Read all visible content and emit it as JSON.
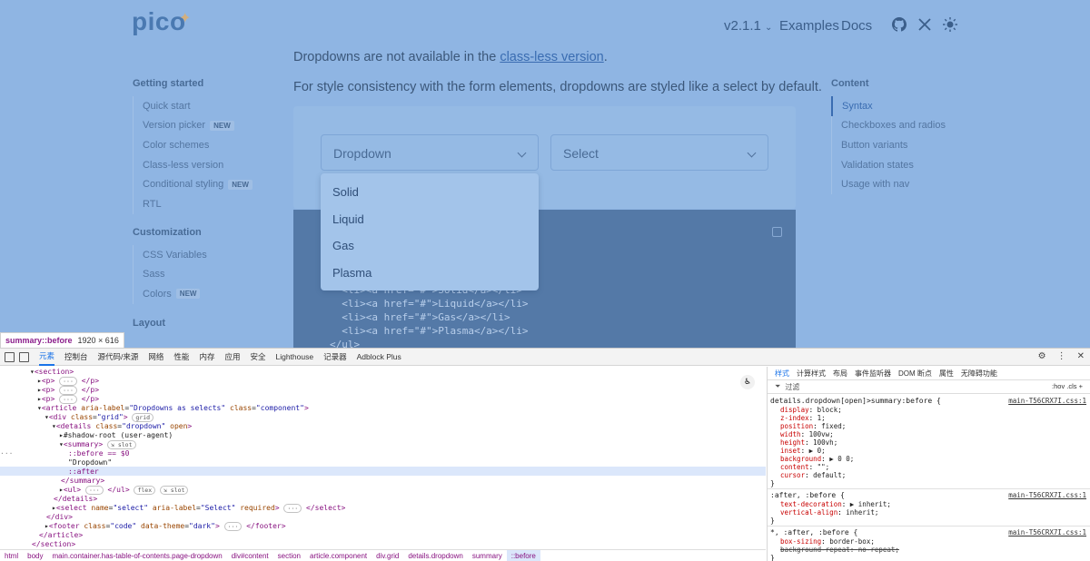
{
  "site": {
    "logo": "pico",
    "version": "v2.1.1",
    "nav": {
      "examples": "Examples",
      "docs": "Docs"
    },
    "nav_icons": [
      "github-icon",
      "x-icon",
      "theme-toggle-icon"
    ]
  },
  "intro": {
    "line1_prefix": "Dropdowns are not available in the ",
    "line1_link": "class-less version",
    "line1_suffix": ".",
    "line2": "For style consistency with the form elements, dropdowns are styled like a select by default."
  },
  "sidebar": {
    "sections": [
      {
        "title": "Getting started",
        "items": [
          {
            "label": "Quick start",
            "badge": ""
          },
          {
            "label": "Version picker",
            "badge": "NEW"
          },
          {
            "label": "Color schemes",
            "badge": ""
          },
          {
            "label": "Class-less version",
            "badge": ""
          },
          {
            "label": "Conditional styling",
            "badge": "NEW"
          },
          {
            "label": "RTL",
            "badge": ""
          }
        ]
      },
      {
        "title": "Customization",
        "items": [
          {
            "label": "CSS Variables",
            "badge": ""
          },
          {
            "label": "Sass",
            "badge": ""
          },
          {
            "label": "Colors",
            "badge": "NEW"
          }
        ]
      },
      {
        "title": "Layout",
        "items": []
      }
    ]
  },
  "toc": {
    "title": "Content",
    "items": [
      "Syntax",
      "Checkboxes and radios",
      "Button variants",
      "Validation states",
      "Usage with nav"
    ],
    "active": "Syntax"
  },
  "demo": {
    "dropdown_label": "Dropdown",
    "select_label": "Select",
    "options": [
      "Solid",
      "Liquid",
      "Gas",
      "Plasma"
    ]
  },
  "code_lines": [
    "  <li><a href=\"#\">Solid</a></li>",
    "  <li><a href=\"#\">Liquid</a></li>",
    "  <li><a href=\"#\">Gas</a></li>",
    "  <li><a href=\"#\">Plasma</a></li>",
    "</ul>"
  ],
  "inspect_tooltip": {
    "selector": "summary::before",
    "size": "1920 × 616"
  },
  "devtools": {
    "tabs": [
      "元素",
      "控制台",
      "源代码/来源",
      "网络",
      "性能",
      "内存",
      "应用",
      "安全",
      "Lighthouse",
      "记录器",
      "Adblock Plus"
    ],
    "active_tab": "元素",
    "breadcrumbs": [
      "html",
      "body",
      "main.container.has-table-of-contents.page-dropdown",
      "div#content",
      "section",
      "article.component",
      "div.grid",
      "details.dropdown",
      "summary",
      "::before"
    ],
    "styles_tabs": [
      "样式",
      "计算样式",
      "布局",
      "事件监听器",
      "DOM 断点",
      "属性",
      "无障碍功能"
    ],
    "filter_placeholder": "过滤",
    "filter_actions": ":hov  .cls  +",
    "dom": {
      "section": "section",
      "p": "p",
      "article_label": "Dropdowns as selects",
      "article_class": "component",
      "grid_class": "grid",
      "grid_pill": "grid",
      "details_class": "dropdown",
      "details_open": "open",
      "shadow_root": "#shadow-root (user-agent)",
      "summary": "summary",
      "slot_pill": "slot",
      "before": "::before == $0",
      "text": "\"Dropdown\"",
      "after": "::after",
      "ul": "ul",
      "flex_pill": "flex",
      "select_name": "select",
      "select_label": "Select",
      "select_required": "required",
      "footer_class": "code",
      "footer_theme": "dark"
    },
    "rules": [
      {
        "selector": "details.dropdown[open]>summary:before {",
        "source": "main-T56CRX7I.css:1",
        "props": [
          [
            "display",
            "block;"
          ],
          [
            "z-index",
            "1;"
          ],
          [
            "position",
            "fixed;"
          ],
          [
            "width",
            "100vw;"
          ],
          [
            "height",
            "100vh;"
          ],
          [
            "inset",
            "▶ 0;"
          ],
          [
            "background",
            "▶ 0 0;"
          ],
          [
            "content",
            "\"\";"
          ],
          [
            "cursor",
            "default;"
          ]
        ]
      },
      {
        "selector": ":after, :before {",
        "source": "main-T56CRX7I.css:1",
        "props": [
          [
            "text-decoration",
            "▶ inherit;"
          ],
          [
            "vertical-align",
            "inherit;"
          ]
        ]
      },
      {
        "selector": "*, :after, :before {",
        "source": "main-T56CRX7I.css:1",
        "props": [
          [
            "box-sizing",
            "border-box;"
          ],
          [
            "background-repeat",
            "no-repeat;"
          ]
        ]
      }
    ]
  }
}
